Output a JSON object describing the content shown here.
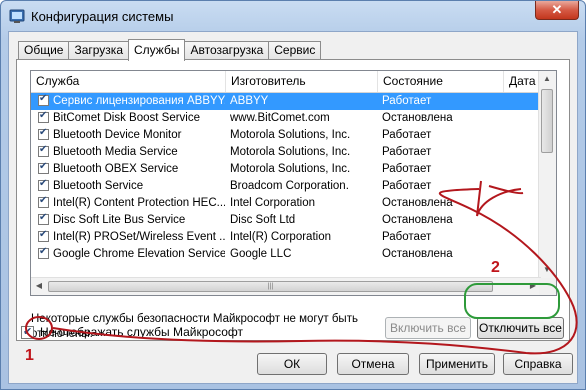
{
  "window": {
    "title": "Конфигурация системы",
    "close_symbol": "✕"
  },
  "tabs": [
    "Общие",
    "Загрузка",
    "Службы",
    "Автозагрузка",
    "Сервис"
  ],
  "active_tab": "Службы",
  "columns": [
    "Служба",
    "Изготовитель",
    "Состояние",
    "Дата о"
  ],
  "services": [
    {
      "name": "Сервис лицензирования ABBYY...",
      "maker": "ABBYY",
      "status": "Работает",
      "checked": true,
      "selected": true
    },
    {
      "name": "BitComet Disk Boost Service",
      "maker": "www.BitComet.com",
      "status": "Остановлена",
      "checked": true
    },
    {
      "name": "Bluetooth Device Monitor",
      "maker": "Motorola Solutions, Inc.",
      "status": "Работает",
      "checked": true
    },
    {
      "name": "Bluetooth Media Service",
      "maker": "Motorola Solutions, Inc.",
      "status": "Работает",
      "checked": true
    },
    {
      "name": "Bluetooth OBEX Service",
      "maker": "Motorola Solutions, Inc.",
      "status": "Работает",
      "checked": true
    },
    {
      "name": "Bluetooth Service",
      "maker": "Broadcom Corporation.",
      "status": "Работает",
      "checked": true
    },
    {
      "name": "Intel(R) Content Protection HEC...",
      "maker": "Intel Corporation",
      "status": "Остановлена",
      "checked": true
    },
    {
      "name": "Disc Soft Lite Bus Service",
      "maker": "Disc Soft Ltd",
      "status": "Остановлена",
      "checked": true
    },
    {
      "name": "Intel(R) PROSet/Wireless Event ...",
      "maker": "Intel(R) Corporation",
      "status": "Работает",
      "checked": true
    },
    {
      "name": "Google Chrome Elevation Service",
      "maker": "Google LLC",
      "status": "Остановлена",
      "checked": true
    }
  ],
  "notice": "Некоторые службы безопасности Майкрософт не могут быть отключены.",
  "buttons": {
    "enable_all": "Включить все",
    "disable_all": "Отключить все",
    "ok": "ОК",
    "cancel": "Отмена",
    "apply": "Применить",
    "help": "Справка"
  },
  "hide_ms": {
    "label": "Не отображать службы Майкрософт",
    "checked": true
  },
  "annotations": {
    "marker_1": "1",
    "marker_2": "2",
    "color": "#c0151b",
    "highlight_color": "#2e9a3a"
  }
}
